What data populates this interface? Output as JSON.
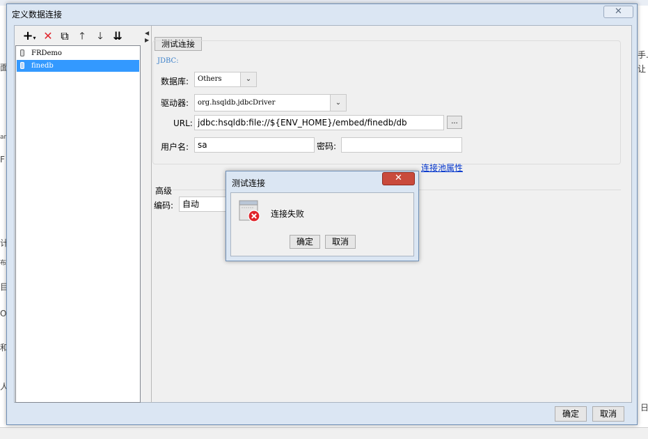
{
  "background": {
    "right_text_1": "手.",
    "right_text_2": "让",
    "left_chars": [
      "面",
      "ar",
      "F",
      "计",
      "布",
      "目",
      "O",
      "和",
      "人"
    ],
    "bottom_right_char": "日"
  },
  "dialog": {
    "title": "定义数据连接",
    "close_glyph": "✕",
    "ok_label": "确定",
    "cancel_label": "取消"
  },
  "toolbar": {
    "add_glyph": "+",
    "add_arrow": "▾",
    "delete_glyph": "✕",
    "copy_glyph": "⧉",
    "up_glyph": "🡑",
    "down_glyph": "🡓",
    "sort_glyph": "⇊"
  },
  "connections": [
    {
      "label": "FRDemo",
      "selected": false
    },
    {
      "label": "finedb",
      "selected": true
    }
  ],
  "form": {
    "test_button": "测试连接",
    "group_title": "JDBC:",
    "database_label": "数据库:",
    "database_value": "Others",
    "driver_label": "驱动器:",
    "driver_value": "org.hsqldb.jdbcDriver",
    "url_label": "URL:",
    "url_value": "jdbc:hsqldb:file://${ENV_HOME}/embed/finedb/db",
    "url_browse": "...",
    "username_label": "用户名:",
    "username_value": "sa",
    "password_label": "密码:",
    "password_value": "",
    "pool_link": "连接池属性",
    "advanced_label": "高级",
    "encoding_label": "编码:",
    "encoding_value": "自动"
  },
  "message_dialog": {
    "title": "测试连接",
    "close_glyph": "✕",
    "message": "连接失败",
    "ok_label": "确定",
    "cancel_label": "取消"
  },
  "colors": {
    "selection": "#3399ff",
    "error_red": "#e0242b",
    "link_blue": "#0033cc",
    "frame_blue": "#dbe6f3"
  }
}
